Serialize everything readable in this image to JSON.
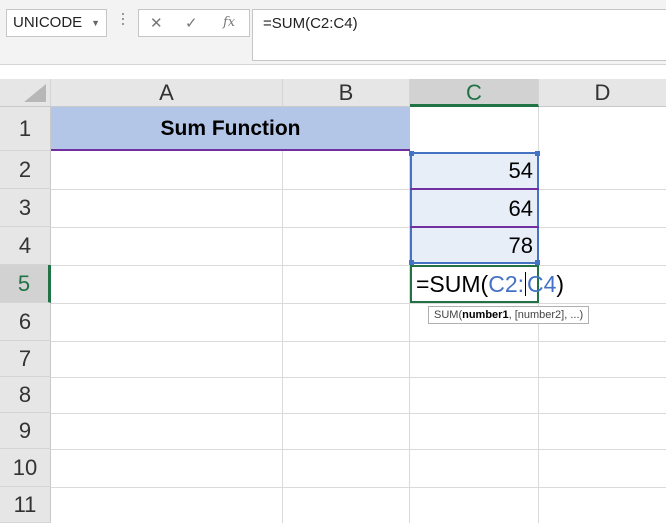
{
  "formula_bar": {
    "name_box": "UNICODE",
    "cancel_icon": "✕",
    "enter_icon": "✓",
    "fx_label": "fx",
    "formula": "=SUM(C2:C4)"
  },
  "columns": [
    "A",
    "B",
    "C",
    "D"
  ],
  "rows": [
    "1",
    "2",
    "3",
    "4",
    "5",
    "6",
    "7",
    "8",
    "9",
    "10",
    "11"
  ],
  "cells": {
    "title": "Sum Function",
    "c2": "54",
    "c3": "64",
    "c4": "78"
  },
  "edit_cell": {
    "prefix": "=SUM(",
    "ref1": "C2",
    "colon": ":",
    "ref2": "C4",
    "suffix": ")"
  },
  "tooltip": {
    "fn": "SUM(",
    "arg1": "number1",
    "rest": ", [number2], ...)"
  },
  "colors": {
    "excel_green": "#217346",
    "range_blue": "#4472c4",
    "title_fill": "#b4c6e7",
    "purple_border": "#7030a0"
  }
}
